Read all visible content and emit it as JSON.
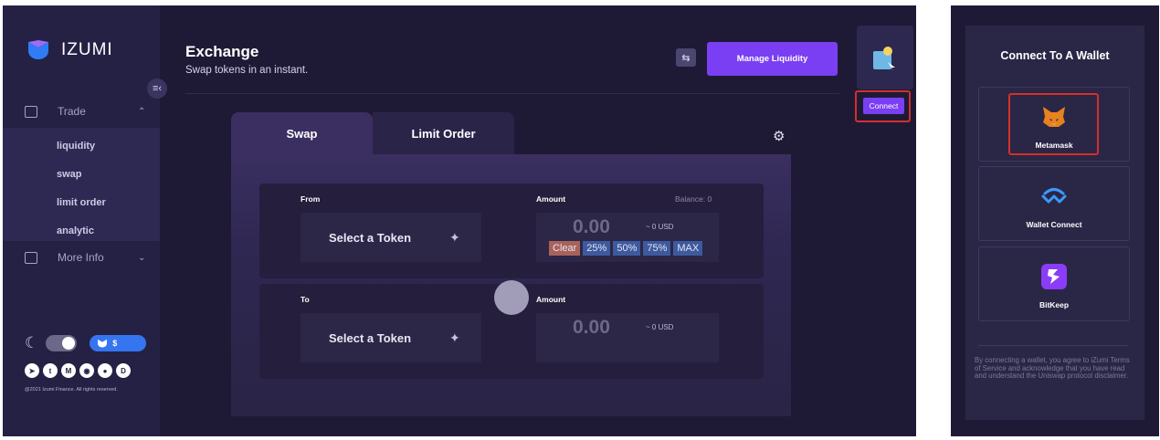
{
  "brand": {
    "name": "IZUMI"
  },
  "sidebar": {
    "trade_label": "Trade",
    "sub_items": [
      "liquidity",
      "swap",
      "limit order",
      "analytic"
    ],
    "more_label": "More Info",
    "price_label": "$",
    "socials": [
      "telegram",
      "twitter",
      "medium",
      "discord",
      "reddit",
      "d"
    ],
    "copyright": "@2021 Izumi Finance. All rights reserved."
  },
  "header": {
    "title": "Exchange",
    "subtitle": "Swap tokens in an instant.",
    "manage_label": "Manage Liquidity",
    "connect_label": "Connect"
  },
  "card": {
    "tabs": [
      "Swap",
      "Limit Order"
    ],
    "from": {
      "label": "From",
      "amount_label": "Amount",
      "balance": "Balance: 0",
      "token_placeholder": "Select a Token",
      "amount": "0.00",
      "usd": "~ 0 USD",
      "quick": [
        "Clear",
        "25%",
        "50%",
        "75%",
        "MAX"
      ]
    },
    "to": {
      "label": "To",
      "amount_label": "Amount",
      "token_placeholder": "Select a Token",
      "amount": "0.00",
      "usd": "~ 0 USD"
    }
  },
  "wallet_panel": {
    "title": "Connect To A Wallet",
    "options": [
      "Metamask",
      "Wallet Connect",
      "BitKeep"
    ],
    "disclaimer": "By connecting a wallet, you agree to iZumi Terms of Service and acknowledge that you have read and understand the Uniswap protocol disclaimer."
  },
  "colors": {
    "accent": "#7a3ff2",
    "highlight": "#d4302a",
    "bg": "#1e1a36"
  }
}
